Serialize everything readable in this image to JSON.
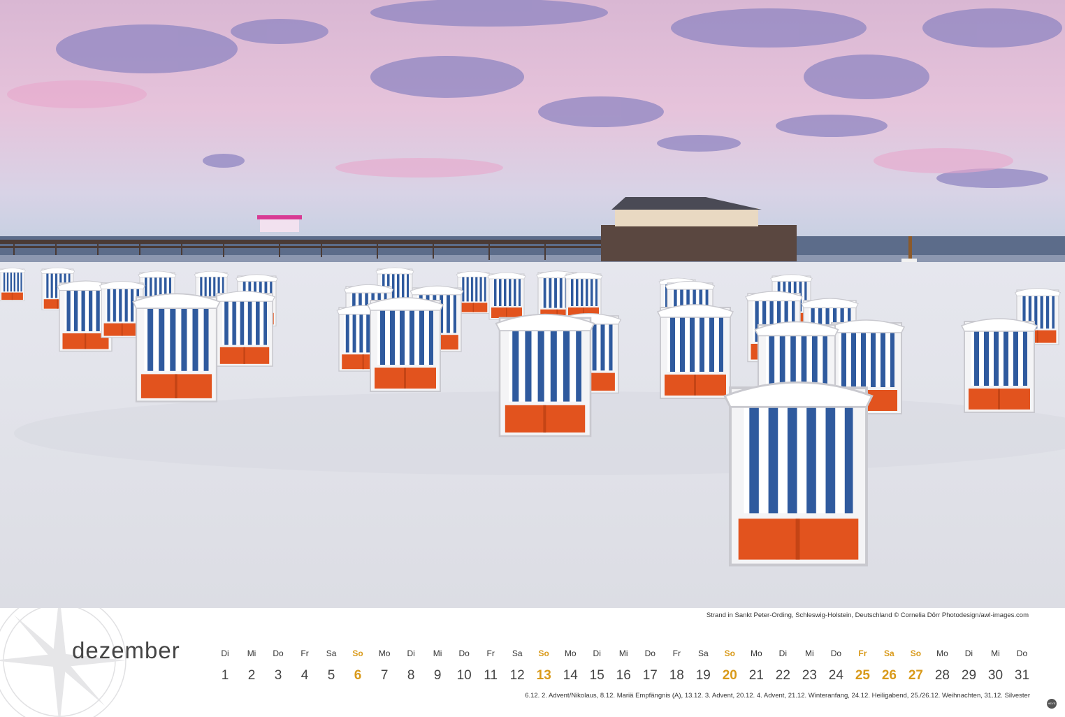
{
  "photo": {
    "description_icon": "beach-chairs-photo",
    "caption": "Strand in Sankt Peter-Ording, Schleswig-Holstein, Deutschland © Cornelia Dörr Photodesign/awl-images.com"
  },
  "calendar": {
    "month": "dezember",
    "days": [
      {
        "wd": "Di",
        "n": "1",
        "hl": false
      },
      {
        "wd": "Mi",
        "n": "2",
        "hl": false
      },
      {
        "wd": "Do",
        "n": "3",
        "hl": false
      },
      {
        "wd": "Fr",
        "n": "4",
        "hl": false
      },
      {
        "wd": "Sa",
        "n": "5",
        "hl": false
      },
      {
        "wd": "So",
        "n": "6",
        "hl": true
      },
      {
        "wd": "Mo",
        "n": "7",
        "hl": false
      },
      {
        "wd": "Di",
        "n": "8",
        "hl": false
      },
      {
        "wd": "Mi",
        "n": "9",
        "hl": false
      },
      {
        "wd": "Do",
        "n": "10",
        "hl": false
      },
      {
        "wd": "Fr",
        "n": "11",
        "hl": false
      },
      {
        "wd": "Sa",
        "n": "12",
        "hl": false
      },
      {
        "wd": "So",
        "n": "13",
        "hl": true
      },
      {
        "wd": "Mo",
        "n": "14",
        "hl": false
      },
      {
        "wd": "Di",
        "n": "15",
        "hl": false
      },
      {
        "wd": "Mi",
        "n": "16",
        "hl": false
      },
      {
        "wd": "Do",
        "n": "17",
        "hl": false
      },
      {
        "wd": "Fr",
        "n": "18",
        "hl": false
      },
      {
        "wd": "Sa",
        "n": "19",
        "hl": false
      },
      {
        "wd": "So",
        "n": "20",
        "hl": true
      },
      {
        "wd": "Mo",
        "n": "21",
        "hl": false
      },
      {
        "wd": "Di",
        "n": "22",
        "hl": false
      },
      {
        "wd": "Mi",
        "n": "23",
        "hl": false
      },
      {
        "wd": "Do",
        "n": "24",
        "hl": false
      },
      {
        "wd": "Fr",
        "n": "25",
        "hl": true
      },
      {
        "wd": "Sa",
        "n": "26",
        "hl": true
      },
      {
        "wd": "So",
        "n": "27",
        "hl": true
      },
      {
        "wd": "Mo",
        "n": "28",
        "hl": false
      },
      {
        "wd": "Di",
        "n": "29",
        "hl": false
      },
      {
        "wd": "Mi",
        "n": "30",
        "hl": false
      },
      {
        "wd": "Do",
        "n": "31",
        "hl": false
      }
    ],
    "holidays": "6.12. 2. Advent/Nikolaus, 8.12. Mariä Empfängnis (A), 13.12. 3. Advent, 20.12. 4. Advent, 21.12. Winteranfang, 24.12. Heiligabend, 25./26.12. Weihnachten, 31.12. Silvester"
  },
  "colors": {
    "highlight": "#d99a1a",
    "stripe_blue": "#2f5a9e",
    "basket_orange": "#e2531e"
  },
  "brand": {
    "logo_icon": "publisher-logo-icon",
    "text": "HEYE"
  }
}
